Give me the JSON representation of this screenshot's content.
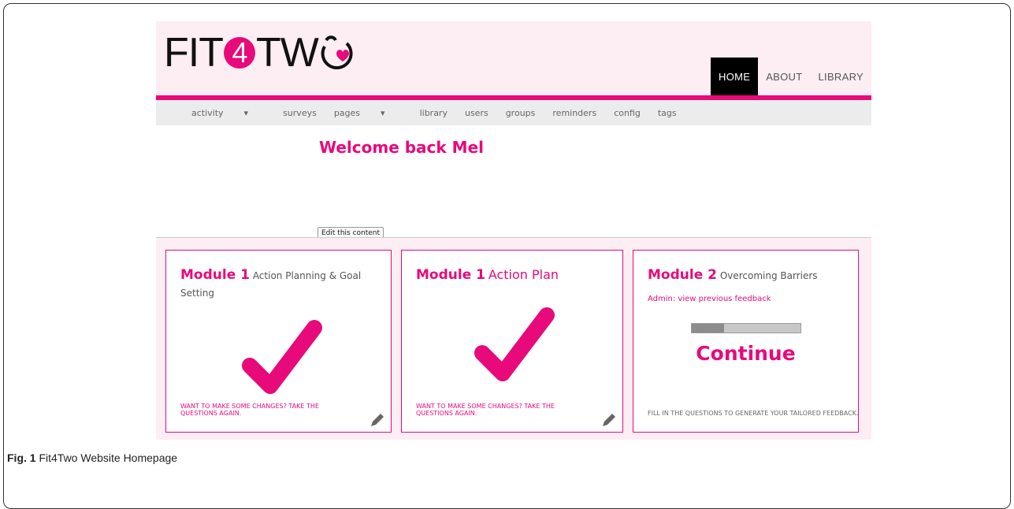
{
  "site": {
    "logo_text_left": "FIT",
    "logo_digit": "4",
    "logo_text_right": "TW",
    "logo_full": "FIT4TWO",
    "main_nav": [
      "HOME",
      "ABOUT",
      "LIBRARY"
    ],
    "admin_nav": [
      {
        "label": "activity",
        "caret": "▾"
      },
      {
        "label": "surveys"
      },
      {
        "label": "pages",
        "caret": "▾"
      },
      {
        "label": "library"
      },
      {
        "label": "users"
      },
      {
        "label": "groups"
      },
      {
        "label": "reminders"
      },
      {
        "label": "config"
      },
      {
        "label": "tags"
      }
    ],
    "welcome": "Welcome back Mel",
    "edit_button": "Edit this content"
  },
  "modules": [
    {
      "module": "Module 1",
      "title": "Action Planning & Goal Setting",
      "footer": "WANT TO MAKE SOME CHANGES? TAKE THE QUESTIONS AGAIN.",
      "status_icon": "checkmark-icon"
    },
    {
      "module": "Module 1",
      "title": "Action Plan",
      "footer": "WANT TO MAKE SOME CHANGES? TAKE THE QUESTIONS AGAIN.",
      "status_icon": "checkmark-icon"
    },
    {
      "module": "Module 2",
      "title": "Overcoming Barriers",
      "admin_link": "Admin: view previous feedback",
      "progress": 0.3,
      "continue": "Continue",
      "footer": "FILL IN THE QUESTIONS TO GENERATE YOUR TAILORED FEEDBACK."
    }
  ],
  "caption": {
    "label": "Fig. 1",
    "text": "Fit4Two Website Homepage"
  },
  "colors": {
    "brand": "#e8097a",
    "header_bg": "#fdeef3",
    "admin_bg": "#ececec"
  }
}
